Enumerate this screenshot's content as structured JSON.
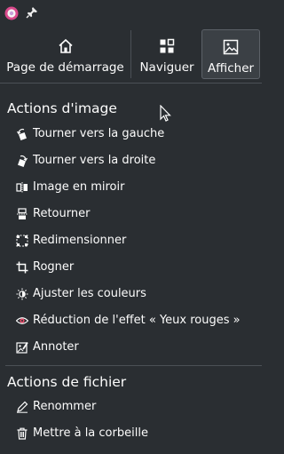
{
  "toolbar": {
    "buttons": [
      {
        "label": "Page de démarrage",
        "icon": "home-icon"
      },
      {
        "label": "Naviguer",
        "icon": "grid-icon"
      },
      {
        "label": "Afficher",
        "icon": "image-icon",
        "active": true
      }
    ]
  },
  "image_actions": {
    "title": "Actions d'image",
    "items": [
      {
        "label": "Tourner vers la gauche",
        "icon": "rotate-left-icon"
      },
      {
        "label": "Tourner vers la droite",
        "icon": "rotate-right-icon"
      },
      {
        "label": "Image en miroir",
        "icon": "mirror-icon"
      },
      {
        "label": "Retourner",
        "icon": "flip-icon"
      },
      {
        "label": "Redimensionner",
        "icon": "resize-icon"
      },
      {
        "label": "Rogner",
        "icon": "crop-icon"
      },
      {
        "label": "Ajuster les couleurs",
        "icon": "adjust-colors-icon"
      },
      {
        "label": "Réduction de l'effet « Yeux rouges »",
        "icon": "red-eye-icon"
      },
      {
        "label": "Annoter",
        "icon": "annotate-icon"
      }
    ]
  },
  "file_actions": {
    "title": "Actions de fichier",
    "items": [
      {
        "label": "Renommer",
        "icon": "rename-icon"
      },
      {
        "label": "Mettre à la corbeille",
        "icon": "trash-icon"
      }
    ]
  },
  "colors": {
    "background": "#2a2e32",
    "text": "#fcfcfc",
    "accent": "#e64d8a",
    "divider": "#4b5056"
  }
}
